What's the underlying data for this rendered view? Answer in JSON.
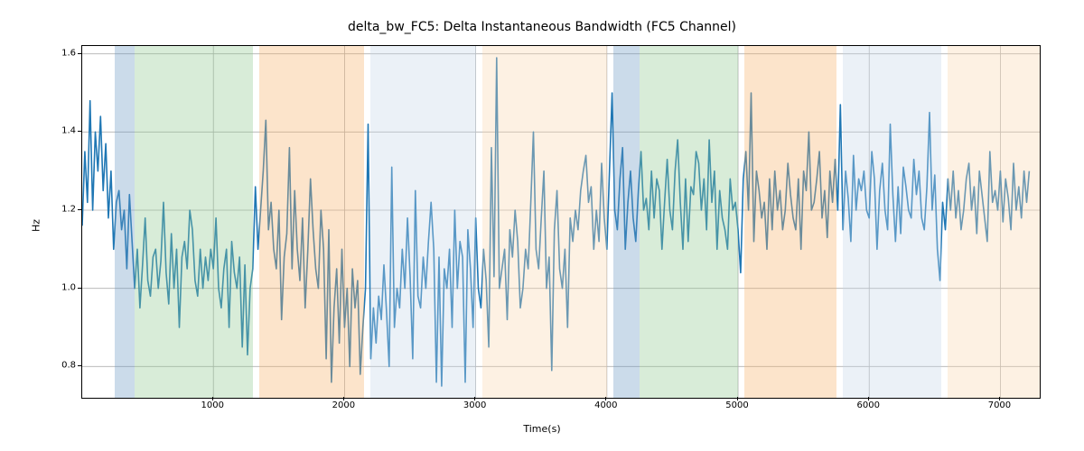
{
  "chart_data": {
    "type": "line",
    "title": "delta_bw_FC5: Delta Instantaneous Bandwidth (FC5 Channel)",
    "xlabel": "Time(s)",
    "ylabel": "Hz",
    "xlim": [
      0,
      7300
    ],
    "ylim": [
      0.72,
      1.62
    ],
    "yticks": [
      0.8,
      1.0,
      1.2,
      1.4,
      1.6
    ],
    "xticks": [
      1000,
      2000,
      3000,
      4000,
      5000,
      6000,
      7000
    ],
    "background_spans": [
      {
        "x0": 250,
        "x1": 400,
        "color": "#6b98c4"
      },
      {
        "x0": 400,
        "x1": 1300,
        "color": "#8fc98f"
      },
      {
        "x0": 1350,
        "x1": 2150,
        "color": "#f5b26b"
      },
      {
        "x0": 2200,
        "x1": 3000,
        "color": "#c7d7e8"
      },
      {
        "x0": 3050,
        "x1": 4000,
        "color": "#f9d8b0"
      },
      {
        "x0": 4050,
        "x1": 4250,
        "color": "#6b98c4"
      },
      {
        "x0": 4250,
        "x1": 5000,
        "color": "#8fc98f"
      },
      {
        "x0": 5050,
        "x1": 5750,
        "color": "#f5b26b"
      },
      {
        "x0": 5800,
        "x1": 6550,
        "color": "#c7d7e8"
      },
      {
        "x0": 6600,
        "x1": 7300,
        "color": "#f9d8b0"
      }
    ],
    "series": [
      {
        "name": "delta_bw_FC5",
        "color": "#1f77b4",
        "x_step": 20,
        "y": [
          1.16,
          1.35,
          1.22,
          1.48,
          1.2,
          1.4,
          1.3,
          1.44,
          1.25,
          1.37,
          1.18,
          1.3,
          1.1,
          1.22,
          1.25,
          1.15,
          1.2,
          1.05,
          1.24,
          1.12,
          1.0,
          1.1,
          0.95,
          1.06,
          1.18,
          1.02,
          0.98,
          1.08,
          1.1,
          1.0,
          1.07,
          1.22,
          1.04,
          0.96,
          1.14,
          1.0,
          1.1,
          0.9,
          1.08,
          1.12,
          1.05,
          1.2,
          1.15,
          1.02,
          0.98,
          1.1,
          1.0,
          1.08,
          1.02,
          1.1,
          1.05,
          1.18,
          1.0,
          0.95,
          1.05,
          1.1,
          0.9,
          1.12,
          1.04,
          1.0,
          1.08,
          0.85,
          1.06,
          0.83,
          1.0,
          1.05,
          1.26,
          1.1,
          1.2,
          1.3,
          1.43,
          1.15,
          1.22,
          1.1,
          1.05,
          1.2,
          0.92,
          1.08,
          1.14,
          1.36,
          1.05,
          1.25,
          1.1,
          1.02,
          1.18,
          0.95,
          1.1,
          1.28,
          1.15,
          1.05,
          1.0,
          1.2,
          1.1,
          0.82,
          1.15,
          0.76,
          0.95,
          1.05,
          0.86,
          1.1,
          0.9,
          1.0,
          0.8,
          1.05,
          0.95,
          1.02,
          0.78,
          0.9,
          1.0,
          1.42,
          0.82,
          0.95,
          0.86,
          0.98,
          0.92,
          1.06,
          0.94,
          0.8,
          1.31,
          0.9,
          1.0,
          0.95,
          1.1,
          1.0,
          1.18,
          1.03,
          0.82,
          1.25,
          0.98,
          0.95,
          1.08,
          1.0,
          1.12,
          1.22,
          1.1,
          0.76,
          1.08,
          0.75,
          1.05,
          1.0,
          1.1,
          0.9,
          1.2,
          1.0,
          1.12,
          1.08,
          0.76,
          1.15,
          1.05,
          0.9,
          1.18,
          1.0,
          0.95,
          1.1,
          1.02,
          0.85,
          1.36,
          1.03,
          1.59,
          1.0,
          1.05,
          1.1,
          0.92,
          1.15,
          1.08,
          1.2,
          1.12,
          0.95,
          1.0,
          1.1,
          1.05,
          1.22,
          1.4,
          1.1,
          1.05,
          1.18,
          1.3,
          1.0,
          1.08,
          0.79,
          1.15,
          1.25,
          1.05,
          1.0,
          1.1,
          0.9,
          1.18,
          1.12,
          1.2,
          1.15,
          1.25,
          1.3,
          1.34,
          1.22,
          1.26,
          1.1,
          1.2,
          1.12,
          1.32,
          1.18,
          1.1,
          1.3,
          1.5,
          1.2,
          1.15,
          1.28,
          1.36,
          1.1,
          1.22,
          1.3,
          1.18,
          1.12,
          1.25,
          1.35,
          1.2,
          1.23,
          1.15,
          1.3,
          1.18,
          1.28,
          1.25,
          1.1,
          1.22,
          1.33,
          1.2,
          1.15,
          1.3,
          1.38,
          1.22,
          1.1,
          1.28,
          1.12,
          1.26,
          1.24,
          1.35,
          1.32,
          1.2,
          1.28,
          1.15,
          1.38,
          1.22,
          1.3,
          1.1,
          1.25,
          1.18,
          1.15,
          1.1,
          1.28,
          1.2,
          1.22,
          1.15,
          1.04,
          1.28,
          1.35,
          1.2,
          1.5,
          1.12,
          1.3,
          1.25,
          1.18,
          1.22,
          1.1,
          1.28,
          1.15,
          1.3,
          1.2,
          1.25,
          1.15,
          1.2,
          1.32,
          1.24,
          1.18,
          1.15,
          1.28,
          1.1,
          1.3,
          1.25,
          1.4,
          1.2,
          1.22,
          1.28,
          1.35,
          1.18,
          1.25,
          1.13,
          1.3,
          1.22,
          1.33,
          1.2,
          1.47,
          1.15,
          1.3,
          1.23,
          1.12,
          1.34,
          1.2,
          1.28,
          1.25,
          1.3,
          1.2,
          1.18,
          1.35,
          1.28,
          1.1,
          1.25,
          1.32,
          1.2,
          1.15,
          1.42,
          1.24,
          1.12,
          1.26,
          1.14,
          1.31,
          1.26,
          1.2,
          1.18,
          1.33,
          1.24,
          1.3,
          1.18,
          1.15,
          1.26,
          1.45,
          1.2,
          1.29,
          1.1,
          1.02,
          1.22,
          1.15,
          1.28,
          1.2,
          1.3,
          1.18,
          1.25,
          1.15,
          1.2,
          1.28,
          1.32,
          1.2,
          1.26,
          1.14,
          1.3,
          1.24,
          1.18,
          1.12,
          1.35,
          1.22,
          1.25,
          1.2,
          1.3,
          1.17,
          1.28,
          1.23,
          1.15,
          1.32,
          1.2,
          1.26,
          1.18,
          1.3,
          1.22,
          1.3
        ]
      }
    ]
  }
}
